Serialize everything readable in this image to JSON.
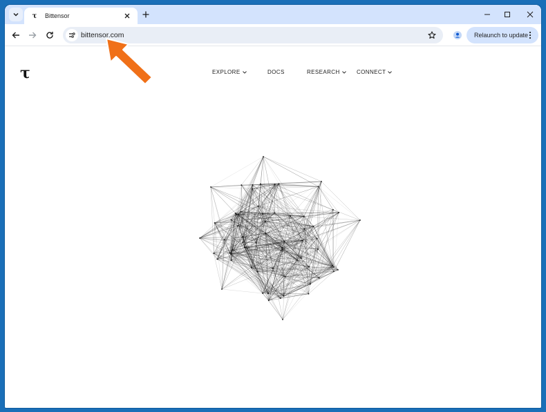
{
  "browser": {
    "tab_title": "Bittensor",
    "tab_favicon": "τ",
    "url": "bittensor.com",
    "relaunch_label": "Relaunch to update",
    "icons": [
      "tab-search-icon",
      "close-icon",
      "plus-icon",
      "minimize-icon",
      "maximize-icon",
      "close-window-icon",
      "back-arrow-icon",
      "forward-arrow-icon",
      "reload-icon",
      "site-info-icon",
      "bookmark-star-icon",
      "profile-icon",
      "kebab-menu-icon"
    ]
  },
  "site": {
    "logo": "τ",
    "nav": [
      {
        "label": "EXPLORE",
        "has_dropdown": true
      },
      {
        "label": "DOCS",
        "has_dropdown": false
      },
      {
        "label": "RESEARCH",
        "has_dropdown": true
      },
      {
        "label": "CONNECT",
        "has_dropdown": true
      }
    ],
    "hero_graphic": "network-graph"
  },
  "annotation": {
    "arrow_color": "#f07018"
  },
  "colors": {
    "tabstrip": "#d3e3fd",
    "omnibox": "#e9eef6",
    "desktop": "#1a6fb8"
  }
}
